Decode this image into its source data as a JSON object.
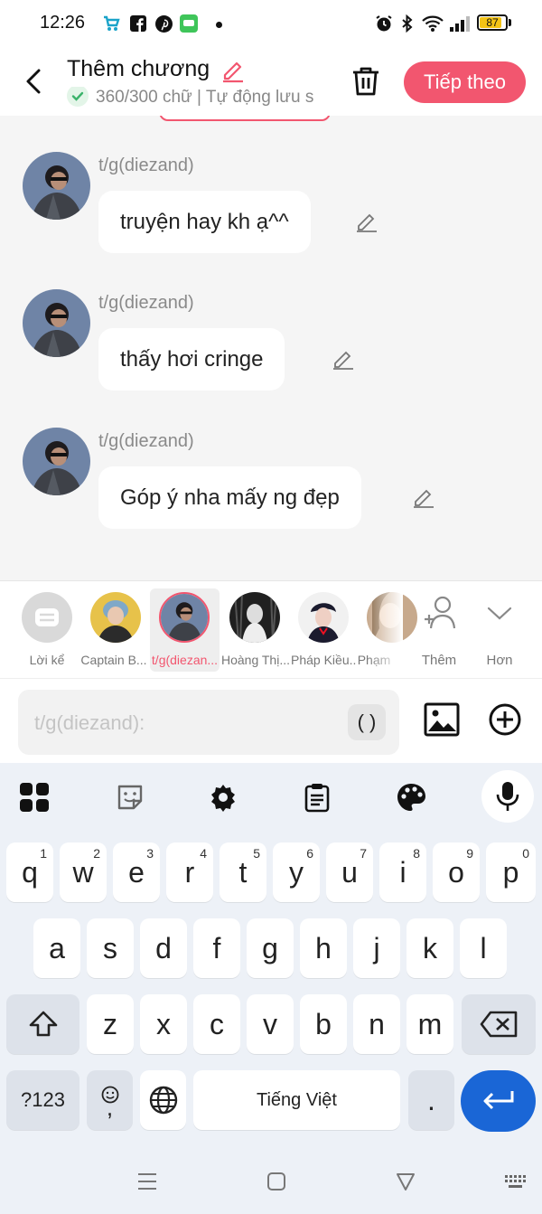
{
  "status_bar": {
    "time": "12:26",
    "battery": "87",
    "battery_level": 0.87,
    "left_icons": [
      "shop-icon",
      "facebook-icon",
      "pinterest-icon",
      "messages-icon"
    ],
    "right_icons": [
      "alarm-icon",
      "bluetooth-icon",
      "wifi-icon",
      "signal-icon"
    ]
  },
  "header": {
    "title": "Thêm chương",
    "subtitle": "360/300 chữ | Tự động lưu s",
    "next_label": "Tiếp theo",
    "accent": "#f2566f"
  },
  "messages": [
    {
      "speaker": "t/g(diezand)",
      "text": "truyện hay kh ạ^^"
    },
    {
      "speaker": "t/g(diezand)",
      "text": "thấy hơi cringe"
    },
    {
      "speaker": "t/g(diezand)",
      "text": "Góp ý nha mấy ng đẹp"
    }
  ],
  "characters": [
    {
      "label": "Lời kể"
    },
    {
      "label": "Captain B..."
    },
    {
      "label": "t/g(diezan..."
    },
    {
      "label": "Hoàng Thị..."
    },
    {
      "label": "Pháp Kiều..."
    },
    {
      "label": "Phạm"
    }
  ],
  "strip_actions": {
    "add_label": "Thêm",
    "more_label": "Hơn"
  },
  "input": {
    "placeholder": "t/g(diezand):",
    "paren_label": "( )"
  },
  "keyboard": {
    "row1": [
      {
        "k": "q",
        "s": "1"
      },
      {
        "k": "w",
        "s": "2"
      },
      {
        "k": "e",
        "s": "3"
      },
      {
        "k": "r",
        "s": "4"
      },
      {
        "k": "t",
        "s": "5"
      },
      {
        "k": "y",
        "s": "6"
      },
      {
        "k": "u",
        "s": "7"
      },
      {
        "k": "i",
        "s": "8"
      },
      {
        "k": "o",
        "s": "9"
      },
      {
        "k": "p",
        "s": "0"
      }
    ],
    "row2": [
      "a",
      "s",
      "d",
      "f",
      "g",
      "h",
      "j",
      "k",
      "l"
    ],
    "row3": [
      "z",
      "x",
      "c",
      "v",
      "b",
      "n",
      "m"
    ],
    "symbols_label": "?123",
    "comma_label": ",",
    "space_label": "Tiếng Việt",
    "period_label": ".",
    "enter_color": "#1a66d6"
  }
}
